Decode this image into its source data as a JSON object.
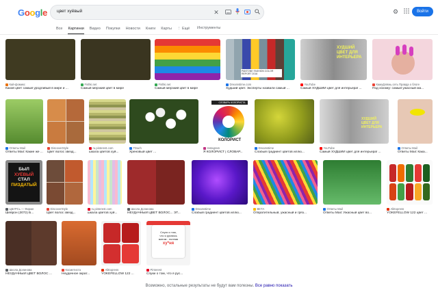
{
  "header": {
    "logo_letters": [
      {
        "ch": "G",
        "color": "#4285f4"
      },
      {
        "ch": "o",
        "color": "#ea4335"
      },
      {
        "ch": "o",
        "color": "#fbbc05"
      },
      {
        "ch": "g",
        "color": "#4285f4"
      },
      {
        "ch": "l",
        "color": "#34a853"
      },
      {
        "ch": "e",
        "color": "#ea4335"
      }
    ],
    "query": "цвет хуёвый",
    "signin_label": "Войти"
  },
  "tabs": {
    "items": [
      "Все",
      "Картинки",
      "Видео",
      "Покупки",
      "Новости",
      "Книги",
      "Карты",
      "⋮ Ещё"
    ],
    "active": "Картинки",
    "tools_label": "Инструменты"
  },
  "results": [
    {
      "src": "Кай-фомикс",
      "title": "Какой цвет самый уродливый в мире и ...",
      "fav": "#e8710a"
    },
    {
      "src": "Fishki.net",
      "title": "Самый мерзкий цвет в мире",
      "fav": "#34a853"
    },
    {
      "src": "Fishki.net",
      "title": "Самый мерзкий цвет в мире",
      "fav": "#34a853"
    },
    {
      "src": "Dreamstime.com",
      "title": "Худший цвет. Эксперты назвали самый ...",
      "fav": "#1a73e8"
    },
    {
      "src": "YouTube",
      "title": "Самый ХУДШИЙ цвет для интерьера! ...",
      "fav": "#ff0000"
    },
    {
      "src": "Камуфляжь.сеть Правда о блоге",
      "title": "Под хохому: самый ужасный ма...",
      "fav": "#ea4335"
    },
    {
      "src": "Ответы Mail",
      "title": "Ответы Mail: Какие же ...",
      "fav": "#1a73e8"
    },
    {
      "src": "DiscoverStyle",
      "title": "Цвет волос звезд...",
      "fav": "#ea4335"
    },
    {
      "src": "ru.pinterest.com",
      "title": "шкала цветов хуй...",
      "fav": "#e60023"
    },
    {
      "src": "TDach",
      "title": "Хреновый цвет ...",
      "fav": "#1a73e8"
    },
    {
      "src": "Instagram",
      "title": "Я КОЛОРИСТ | СЛОВАР...",
      "fav": "#c13584"
    },
    {
      "src": "Dreamstime",
      "title": "Слабый градиент цветов иллю...",
      "fav": "#1a73e8"
    },
    {
      "src": "YouTube",
      "title": "Самый ХУДШИЙ цвет для интерьера! ...",
      "fav": "#ff0000"
    },
    {
      "src": "Ответы Mail",
      "title": "Ответы Mail: Кака...",
      "fav": "#1a73e8"
    },
    {
      "src": "ЦБУРСь — Фирме",
      "title": "Шеврон (3072) Б...",
      "fav": "#5f6368"
    },
    {
      "src": "DiscoverStyle",
      "title": "Цвет волос звезд...",
      "fav": "#ea4335"
    },
    {
      "src": "ru.pinterest.com",
      "title": "шкала цветов хуй...",
      "fav": "#e60023"
    },
    {
      "src": "Школа Долинова",
      "title": "НЕУДАЧНЫЙ ЦВЕТ ВОЛОС... ЭТ...",
      "fav": "#5f6368"
    },
    {
      "src": "Dreamstime",
      "title": "Слабый градиент цветов иллю...",
      "fav": "#1a73e8"
    },
    {
      "src": "ВЕТА",
      "title": "Отвратительный, ужасный и гряз...",
      "fav": "#fbbc05"
    },
    {
      "src": "Ответы Mail",
      "title": "Ответы Mail: Ужасный цвет во...",
      "fav": "#1a73e8"
    },
    {
      "src": "AliExpress",
      "title": "YOKEFELLOW 122 цвет ...",
      "fav": "#e62e04"
    },
    {
      "src": "Школа Долинова",
      "title": "НЕУДАЧНЫЙ ЦВЕТ ВОЛОС ...",
      "fav": "#5f6368"
    },
    {
      "src": "Косметиста",
      "title": "Неудачное ократ...",
      "fav": "#ea4335"
    },
    {
      "src": "AliExpress",
      "title": "YOKEFELLOW 122 ...",
      "fav": "#e62e04"
    },
    {
      "src": "Pinterest",
      "title": "Спуки о том, что я рус...",
      "fav": "#e60023"
    }
  ],
  "image_texts": {
    "pantone": "PANTONE FASHION COLOR REPORT 2016",
    "colorist": "СЛОВАРЬ КОЛОРИСТА",
    "colorist_big": "КОЛОРИСТ",
    "yt_overlay": "ХУДШИЙ ЦВЕТ ДЛЯ ИНТЕРЬЕРА",
    "patch_lines": [
      "БЫЛ",
      "ХУЁВЫЙ",
      "СТАЛ",
      "ПИЗДАТЫЙ"
    ],
    "mug_lines": [
      "Слухи о том,",
      "что я ругаюсь",
      "матом - полная",
      "ху*ня"
    ]
  },
  "footer": {
    "text": "Возможно, остальные результаты не будут вам полезны.",
    "link": "Все равно показать"
  }
}
